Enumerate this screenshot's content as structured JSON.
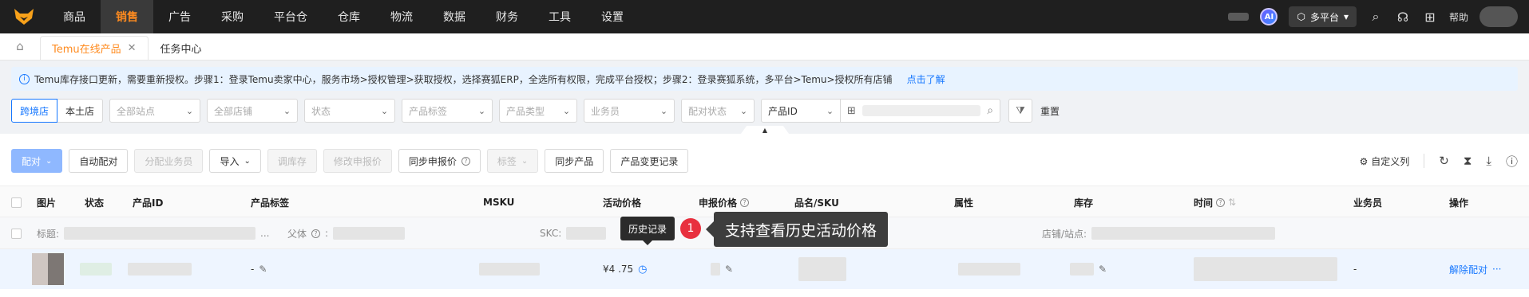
{
  "nav": {
    "items": [
      "商品",
      "销售",
      "广告",
      "采购",
      "平台仓",
      "仓库",
      "物流",
      "数据",
      "财务",
      "工具",
      "设置"
    ],
    "active_index": 1
  },
  "topbar": {
    "ai_label": "AI",
    "platform_label": "多平台",
    "help_label": "帮助"
  },
  "tabs": {
    "items": [
      "Temu在线产品",
      "任务中心"
    ],
    "close_glyph": "✕"
  },
  "notice": {
    "text": "Temu库存接口更新，需要重新授权。步骤1：登录Temu卖家中心，服务市场>授权管理>获取授权，选择赛狐ERP，全选所有权限，完成平台授权；步骤2：登录赛狐系统，多平台>Temu>授权所有店铺",
    "link": "点击了解"
  },
  "filters": {
    "store_type": [
      "跨境店",
      "本土店"
    ],
    "site_placeholder": "全部站点",
    "shop_placeholder": "全部店铺",
    "status_placeholder": "状态",
    "tag_placeholder": "产品标签",
    "type_placeholder": "产品类型",
    "salesperson_placeholder": "业务员",
    "pair_status_placeholder": "配对状态",
    "search_field": "产品ID",
    "reset": "重置"
  },
  "toolbar": {
    "pair": "配对",
    "auto_pair": "自动配对",
    "assign_salesperson": "分配业务员",
    "import": "导入",
    "adjust_stock": "调库存",
    "edit_declared_price": "修改申报价",
    "sync_declared_price": "同步申报价",
    "tag": "标签",
    "sync_products": "同步产品",
    "change_log": "产品变更记录",
    "custom_columns": "自定义列"
  },
  "table": {
    "headers": {
      "image": "图片",
      "status": "状态",
      "product_id": "产品ID",
      "product_tag": "产品标签",
      "msku": "MSKU",
      "activity_price": "活动价格",
      "declared_price": "申报价格",
      "name_sku": "品名/SKU",
      "attributes": "属性",
      "stock": "库存",
      "time": "时间",
      "salesperson": "业务员",
      "actions": "操作"
    },
    "group_row": {
      "title_label": "标题:",
      "parent_label": "父体",
      "skc_label": "SKC:",
      "shop_site_label": "店铺/站点:"
    },
    "row": {
      "tag_value": "-",
      "activity_price": "¥4 .75",
      "salesperson": "-",
      "action_link": "解除配对",
      "more": "···"
    }
  },
  "tooltip": {
    "history_label": "历史记录"
  },
  "annotation": {
    "step_number": "1",
    "text": "支持查看历史活动价格"
  },
  "colors": {
    "topbar_bg": "#1f1f1f",
    "accent_orange": "#ff8b1f",
    "link_blue": "#1677ff",
    "badge_red": "#e8303f"
  }
}
